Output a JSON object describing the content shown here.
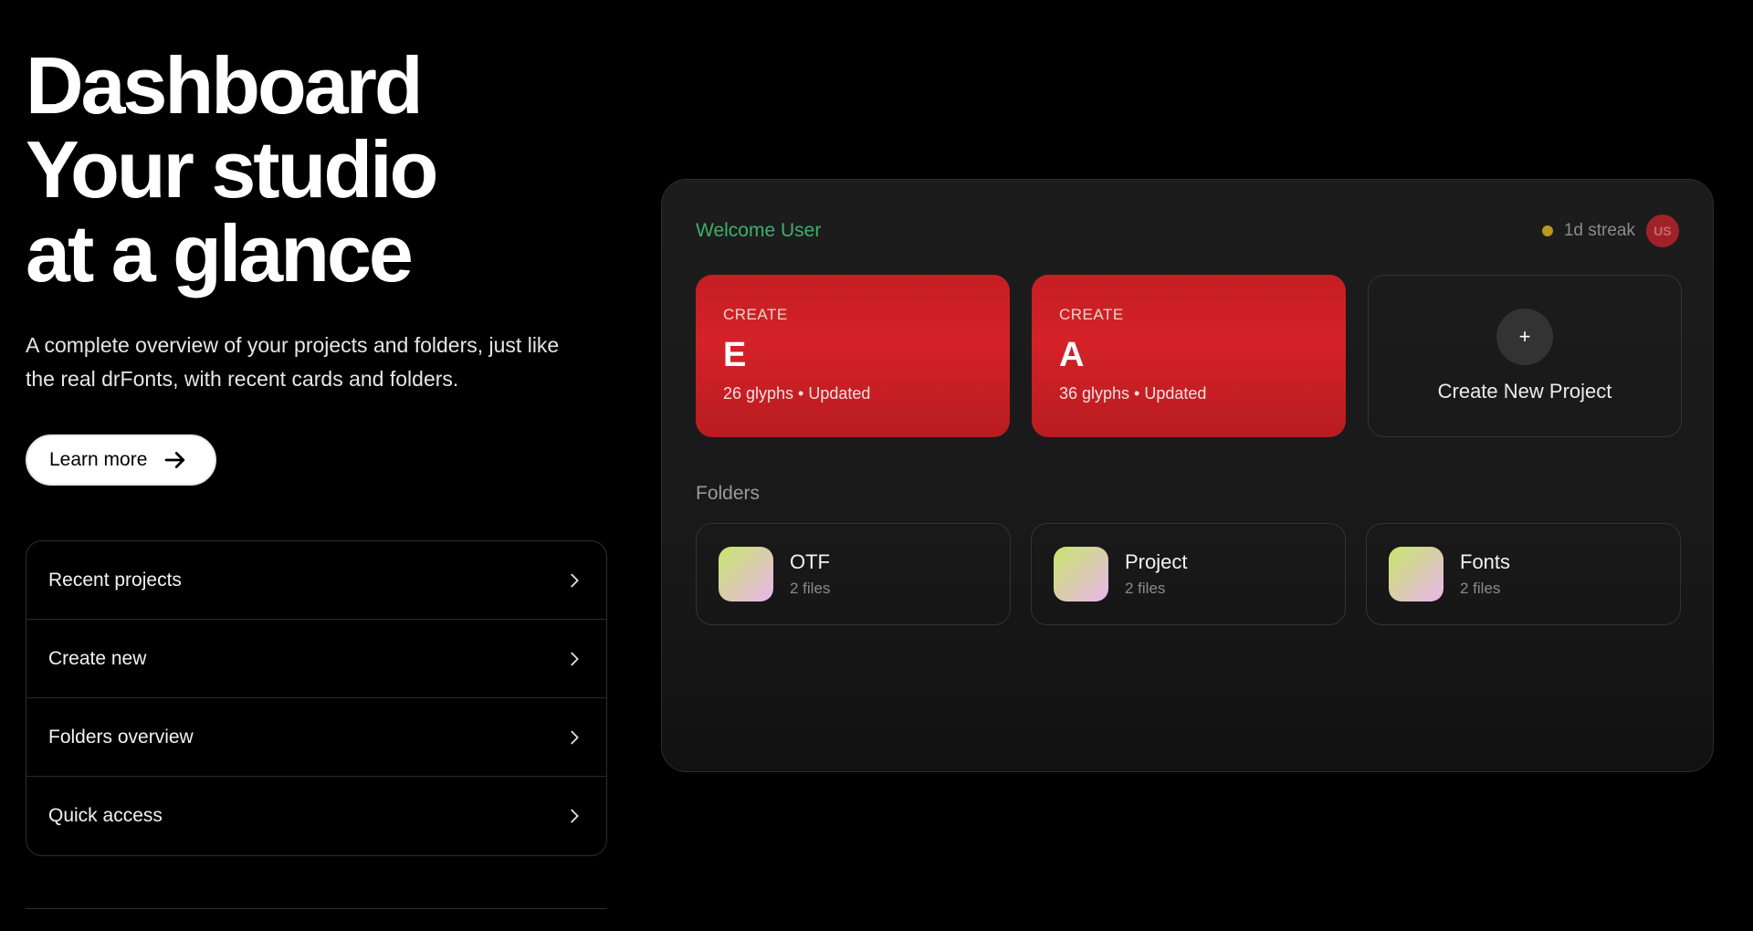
{
  "hero": {
    "title_lines": [
      "Dashboard",
      "Your studio",
      "at a glance"
    ],
    "subtitle": "A complete overview of your projects and folders, just like the real drFonts, with recent cards and folders.",
    "cta_label": "Learn more"
  },
  "menu": {
    "items": [
      {
        "label": "Recent projects"
      },
      {
        "label": "Create new"
      },
      {
        "label": "Folders overview"
      },
      {
        "label": "Quick access"
      }
    ]
  },
  "panel": {
    "welcome": "Welcome User",
    "streak": "1d streak",
    "avatar_initials": "US",
    "cards": [
      {
        "kicker": "CREATE",
        "letter": "E",
        "meta": "26 glyphs • Updated"
      },
      {
        "kicker": "CREATE",
        "letter": "A",
        "meta": "36 glyphs • Updated"
      }
    ],
    "new_project": {
      "icon": "+",
      "label": "Create New Project"
    },
    "folders_title": "Folders",
    "folders": [
      {
        "name": "OTF",
        "count": "2 files"
      },
      {
        "name": "Project",
        "count": "2 files"
      },
      {
        "name": "Fonts",
        "count": "2 files"
      }
    ]
  },
  "colors": {
    "accent_red": "#d42228",
    "welcome_green": "#3db06a",
    "streak_dot": "#b99a1f",
    "background": "#000000"
  },
  "icons": {
    "cta": "arrow-right-icon",
    "menu_item": "chevron-right-icon",
    "folder": "folder-gradient-icon"
  }
}
